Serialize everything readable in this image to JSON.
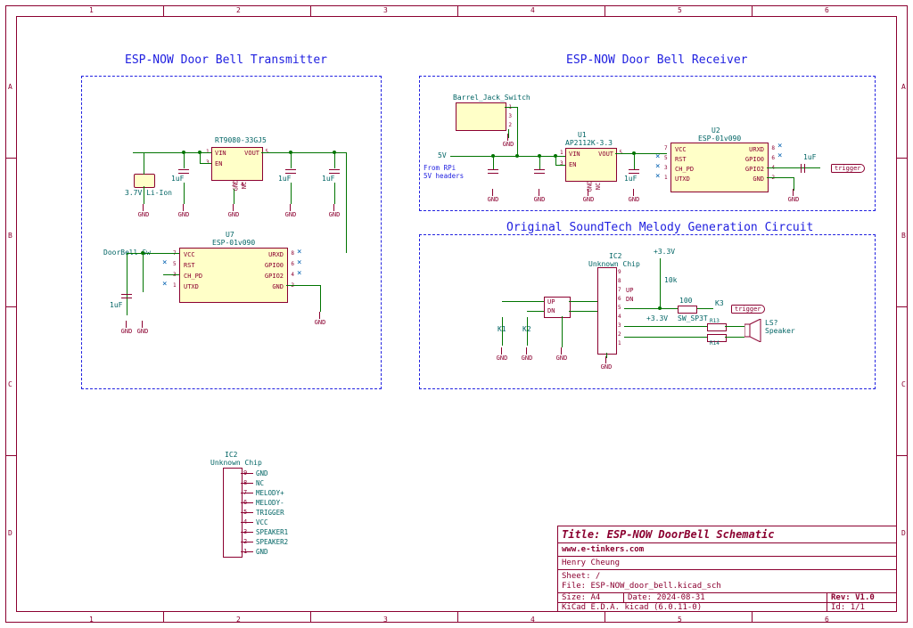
{
  "border": {
    "cols": [
      "1",
      "2",
      "3",
      "4",
      "5",
      "6"
    ],
    "rows": [
      "A",
      "B",
      "C",
      "D"
    ]
  },
  "titleblock": {
    "title_prefix": "Title:",
    "title": "ESP-NOW DoorBell Schematic",
    "url": "www.e-tinkers.com",
    "author": "Henry Cheung",
    "sheet_lbl": "Sheet: /",
    "file_lbl": "File: ESP-NOW_door_bell.kicad_sch",
    "size_lbl": "Size:",
    "size": "A4",
    "date_lbl": "Date:",
    "date": "2024-08-31",
    "rev_lbl": "Rev:",
    "rev": "V1.0",
    "tool": "KiCad E.D.A.  kicad (6.0.11-0)",
    "id_lbl": "Id:",
    "id": "1/1"
  },
  "sections": {
    "tx": {
      "title": "ESP-NOW Door Bell Transmitter"
    },
    "rx": {
      "title": "ESP-NOW Door Bell Receiver"
    },
    "melody": {
      "title": "Original SoundTech Melody Generation Circuit"
    }
  },
  "tx": {
    "reg": {
      "ref": "",
      "type": "RT9080-33GJ5",
      "pins": {
        "vin": "VIN",
        "en": "EN",
        "vout": "VOUT",
        "gnd": "GND",
        "nc": "NC"
      },
      "pinnums": [
        "1",
        "3",
        "5",
        "2",
        "4"
      ]
    },
    "batt": "3.7V Li-Ion",
    "c1": "1uF",
    "c2": "1uF",
    "c3": "1uF",
    "esp": {
      "ref": "U7",
      "type": "ESP-01v090",
      "pins": {
        "vcc": "VCC",
        "rst": "RST",
        "chpd": "CH_PD",
        "utxd": "UTXD",
        "urxd": "URXD",
        "gpio0": "GPIO0",
        "gpio2": "GPIO2",
        "gnd": "GND"
      },
      "pinnums": {
        "vcc": "7",
        "rst": "5",
        "chpd": "3",
        "utxd": "1",
        "urxd": "8",
        "gpio0": "6",
        "gpio2": "4",
        "gnd": "2"
      }
    },
    "door": "DoorBell Sw",
    "gnd": "GND"
  },
  "rx": {
    "jack": {
      "ref": "Barrel_Jack_Switch",
      "pins": [
        "1",
        "2",
        "3"
      ]
    },
    "note1": "From RPi",
    "note2": "5V headers",
    "fivev": "5V",
    "reg": {
      "ref": "U1",
      "type": "AP2112K-3.3",
      "pins": {
        "vin": "VIN",
        "en": "EN",
        "vout": "VOUT",
        "gnd": "GND",
        "nc": "NC"
      },
      "pinnums": [
        "1",
        "3",
        "5",
        "2",
        "4"
      ]
    },
    "c1": "1uF",
    "c2": "1uF",
    "c3": "1uF",
    "esp": {
      "ref": "U2",
      "type": "ESP-01v090",
      "pins": {
        "vcc": "VCC",
        "rst": "RST",
        "chpd": "CH_PD",
        "utxd": "UTXD",
        "urxd": "URXD",
        "gpio0": "GPIO0",
        "gpio2": "GPIO2",
        "gnd": "GND"
      },
      "pinnums": {
        "vcc": "7",
        "rst": "5",
        "chpd": "3",
        "utxd": "1",
        "urxd": "8",
        "gpio0": "6",
        "gpio2": "4",
        "gnd": "2"
      }
    },
    "trigger": "trigger",
    "gnd": "GND"
  },
  "melody": {
    "ic": {
      "ref": "IC2",
      "type": "Unknown Chip",
      "pins": {
        "up": "UP",
        "dn": "DN"
      },
      "nums": [
        "9",
        "8",
        "7",
        "6",
        "5",
        "4",
        "3",
        "2",
        "1"
      ]
    },
    "updn": {
      "up": "UP",
      "dn": "DN"
    },
    "sw": "SW_SP3T",
    "k1": "K1",
    "k2": "K2",
    "k3": "K3",
    "r10k": "10k",
    "r100": "100",
    "r13": "R13",
    "r14": "R14",
    "spk": "LS?",
    "spk2": "Speaker",
    "v33": "+3.3V",
    "trigger": "trigger",
    "gnd": "GND"
  },
  "ic_footprint": {
    "ref": "IC2",
    "type": "Unknown Chip",
    "pins": [
      {
        "n": "9",
        "name": "GND"
      },
      {
        "n": "8",
        "name": "NC"
      },
      {
        "n": "7",
        "name": "MELODY+"
      },
      {
        "n": "6",
        "name": "MELODY-"
      },
      {
        "n": "5",
        "name": "TRIGGER"
      },
      {
        "n": "4",
        "name": "VCC"
      },
      {
        "n": "3",
        "name": "SPEAKER1"
      },
      {
        "n": "2",
        "name": "SPEAKER2"
      },
      {
        "n": "1",
        "name": "GND"
      }
    ]
  }
}
